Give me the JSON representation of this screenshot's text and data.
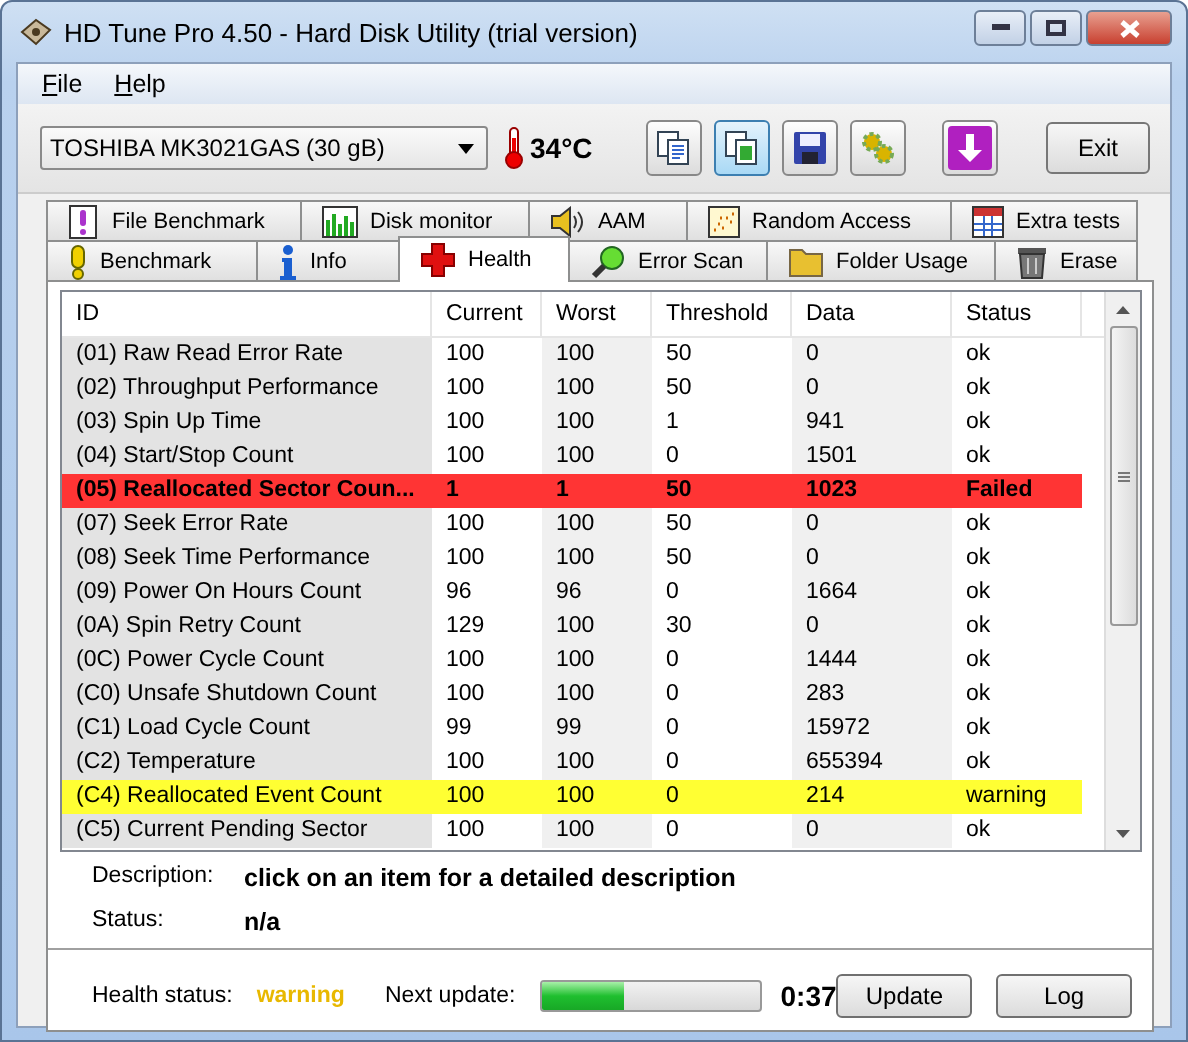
{
  "window": {
    "title": "HD Tune Pro 4.50 - Hard Disk Utility (trial version)"
  },
  "menu": [
    {
      "label": "File"
    },
    {
      "label": "Help"
    }
  ],
  "toolbar": {
    "drive": {
      "name": "TOSHIBA MK3021GAS",
      "capacity": "(30 gB)"
    },
    "temperature": "34°C",
    "buttons": [
      {
        "kind": "copy-text",
        "selected": false
      },
      {
        "kind": "copy-screen",
        "selected": true
      },
      {
        "kind": "save",
        "selected": false
      },
      {
        "kind": "options",
        "selected": false
      },
      {
        "kind": "download",
        "selected": false
      }
    ],
    "exit": "Exit"
  },
  "tab_rows": [
    {
      "tabs": [
        {
          "label": "File Benchmark",
          "selected": false
        },
        {
          "label": "Disk monitor",
          "selected": false
        },
        {
          "label": "AAM",
          "selected": false
        },
        {
          "label": "Random Access",
          "selected": false
        },
        {
          "label": "Extra tests",
          "selected": false
        }
      ]
    },
    {
      "tabs": [
        {
          "label": "Benchmark",
          "selected": false
        },
        {
          "label": "Info",
          "selected": false
        },
        {
          "label": "Health",
          "selected": true
        },
        {
          "label": "Error Scan",
          "selected": false
        },
        {
          "label": "Folder Usage",
          "selected": false
        },
        {
          "label": "Erase",
          "selected": false
        }
      ]
    }
  ],
  "health": {
    "columns": [
      "ID",
      "Current",
      "Worst",
      "Threshold",
      "Data",
      "Status"
    ],
    "rows": [
      {
        "cells": [
          "(01) Raw Read Error Rate",
          "100",
          "100",
          "50",
          "0",
          "ok"
        ],
        "failed": false,
        "warning": false
      },
      {
        "cells": [
          "(02) Throughput Performance",
          "100",
          "100",
          "50",
          "0",
          "ok"
        ],
        "failed": false,
        "warning": false
      },
      {
        "cells": [
          "(03) Spin Up Time",
          "100",
          "100",
          "1",
          "941",
          "ok"
        ],
        "failed": false,
        "warning": false
      },
      {
        "cells": [
          "(04) Start/Stop Count",
          "100",
          "100",
          "0",
          "1501",
          "ok"
        ],
        "failed": false,
        "warning": false
      },
      {
        "cells": [
          "(05) Reallocated Sector Coun...",
          "1",
          "1",
          "50",
          "1023",
          "Failed"
        ],
        "failed": true,
        "warning": false
      },
      {
        "cells": [
          "(07) Seek Error Rate",
          "100",
          "100",
          "50",
          "0",
          "ok"
        ],
        "failed": false,
        "warning": false
      },
      {
        "cells": [
          "(08) Seek Time Performance",
          "100",
          "100",
          "50",
          "0",
          "ok"
        ],
        "failed": false,
        "warning": false
      },
      {
        "cells": [
          "(09) Power On Hours Count",
          "96",
          "96",
          "0",
          "1664",
          "ok"
        ],
        "failed": false,
        "warning": false
      },
      {
        "cells": [
          "(0A) Spin Retry Count",
          "129",
          "100",
          "30",
          "0",
          "ok"
        ],
        "failed": false,
        "warning": false
      },
      {
        "cells": [
          "(0C) Power Cycle Count",
          "100",
          "100",
          "0",
          "1444",
          "ok"
        ],
        "failed": false,
        "warning": false
      },
      {
        "cells": [
          "(C0) Unsafe Shutdown Count",
          "100",
          "100",
          "0",
          "283",
          "ok"
        ],
        "failed": false,
        "warning": false
      },
      {
        "cells": [
          "(C1) Load Cycle Count",
          "99",
          "99",
          "0",
          "15972",
          "ok"
        ],
        "failed": false,
        "warning": false
      },
      {
        "cells": [
          "(C2) Temperature",
          "100",
          "100",
          "0",
          "655394",
          "ok"
        ],
        "failed": false,
        "warning": false
      },
      {
        "cells": [
          "(C4) Reallocated Event Count",
          "100",
          "100",
          "0",
          "214",
          "warning"
        ],
        "failed": false,
        "warning": true
      },
      {
        "cells": [
          "(C5) Current Pending Sector",
          "100",
          "100",
          "0",
          "0",
          "ok"
        ],
        "failed": false,
        "warning": false
      }
    ]
  },
  "details": [
    {
      "label": "Description:",
      "value": "click on an item for a detailed description"
    },
    {
      "label": "Status:",
      "value": "n/a"
    }
  ],
  "footer": {
    "health_label": "Health status:",
    "health_value": "warning",
    "health_warning": true,
    "next_label": "Next update:",
    "level": 0.38,
    "time": "0:37",
    "buttons": [
      "Update",
      "Log"
    ]
  }
}
